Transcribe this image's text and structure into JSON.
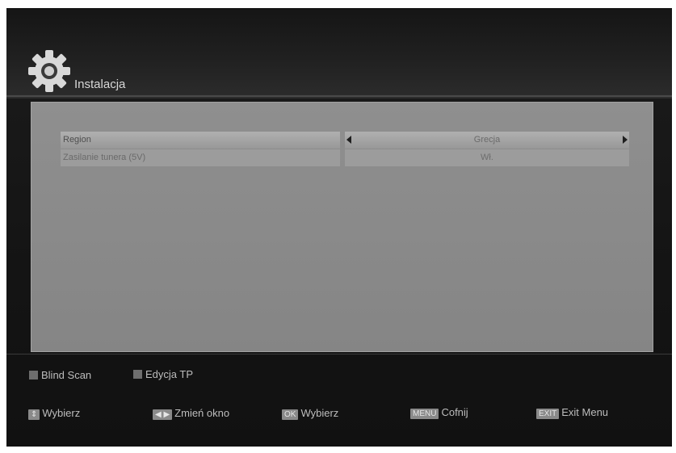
{
  "header": {
    "title": "Instalacja",
    "icon": "gear-icon"
  },
  "settings": [
    {
      "label": "Region",
      "value": "Grecja"
    },
    {
      "label": "Zasilanie tunera (5V)",
      "value": "Wł."
    }
  ],
  "function_keys": {
    "blind_scan": "Blind Scan",
    "tp_edit": "Edycja TP"
  },
  "legend": {
    "select": {
      "key": "⇕",
      "label": "Wybierz"
    },
    "switch_window": {
      "key": "◀ ▶",
      "label": "Zmień okno"
    },
    "ok": {
      "key": "OK",
      "label": "Wybierz"
    },
    "back": {
      "key": "MENU",
      "label": "Cofnij"
    },
    "exit": {
      "key": "EXIT",
      "label": "Exit Menu"
    }
  },
  "colors": {
    "background": "#141414",
    "panel": "#8a8a8a",
    "highlight_row": "#a4a4a4",
    "text": "#bdbdbd"
  }
}
